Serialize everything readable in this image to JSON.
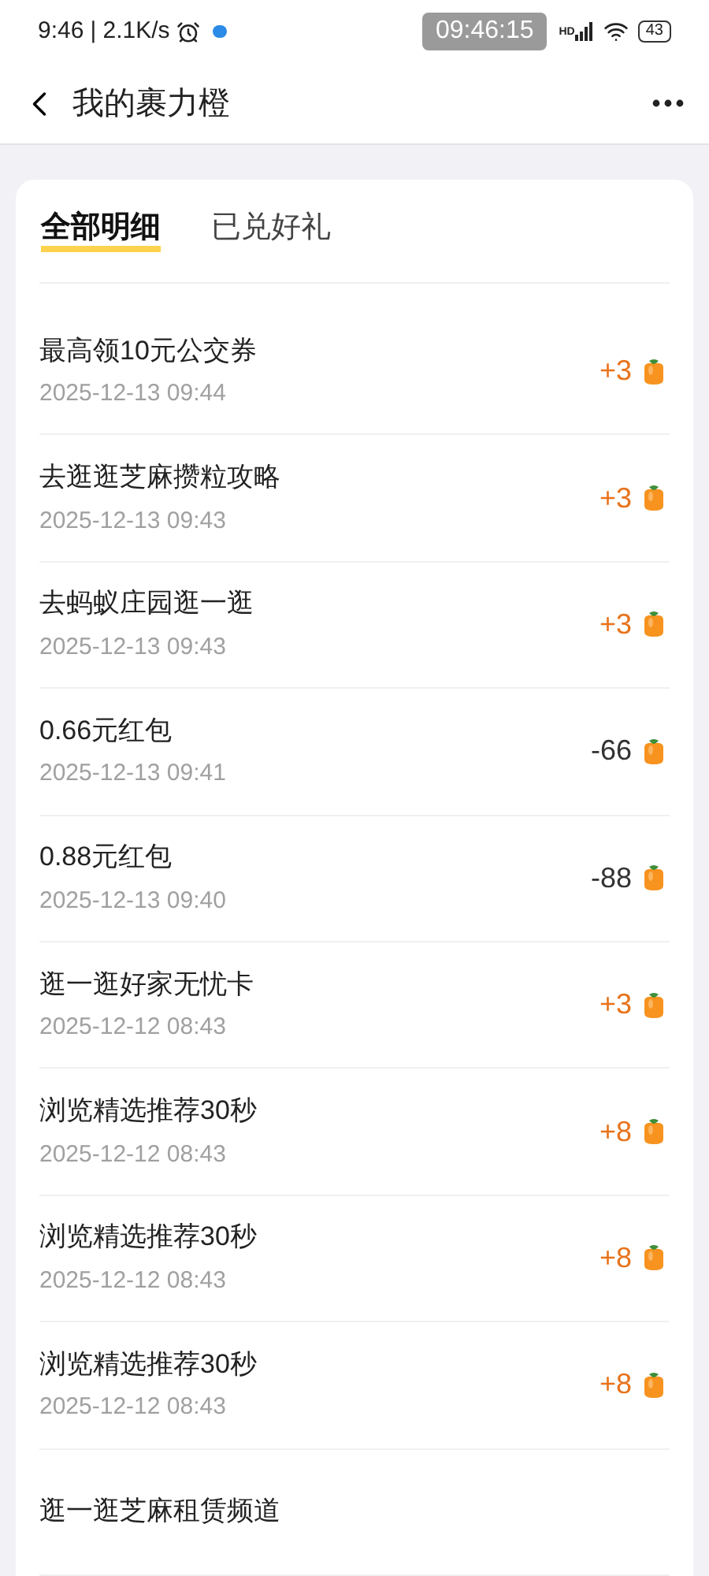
{
  "status_bar": {
    "time": "9:46",
    "speed": "| 2.1K/s",
    "clock_overlay": "09:46:15",
    "network": "HD",
    "battery": "43"
  },
  "header": {
    "title": "我的裹力橙"
  },
  "tabs": [
    {
      "label": "全部明细",
      "selected": true
    },
    {
      "label": "已兑好礼",
      "selected": false
    }
  ],
  "records": [
    {
      "title": "最高领10元公交券",
      "time": "2025-12-13 09:44",
      "amount": "+3",
      "kind": "gain"
    },
    {
      "title": "去逛逛芝麻攒粒攻略",
      "time": "2025-12-13 09:43",
      "amount": "+3",
      "kind": "gain"
    },
    {
      "title": "去蚂蚁庄园逛一逛",
      "time": "2025-12-13 09:43",
      "amount": "+3",
      "kind": "gain"
    },
    {
      "title": "0.66元红包",
      "time": "2025-12-13 09:41",
      "amount": "-66",
      "kind": "spend"
    },
    {
      "title": "0.88元红包",
      "time": "2025-12-13 09:40",
      "amount": "-88",
      "kind": "spend"
    },
    {
      "title": "逛一逛好家无忧卡",
      "time": "2025-12-12 08:43",
      "amount": "+3",
      "kind": "gain"
    },
    {
      "title": "浏览精选推荐30秒",
      "time": "2025-12-12 08:43",
      "amount": "+8",
      "kind": "gain"
    },
    {
      "title": "浏览精选推荐30秒",
      "time": "2025-12-12 08:43",
      "amount": "+8",
      "kind": "gain"
    },
    {
      "title": "浏览精选推荐30秒",
      "time": "2025-12-12 08:43",
      "amount": "+8",
      "kind": "gain"
    },
    {
      "title": "逛一逛芝麻租赁频道"
    }
  ]
}
